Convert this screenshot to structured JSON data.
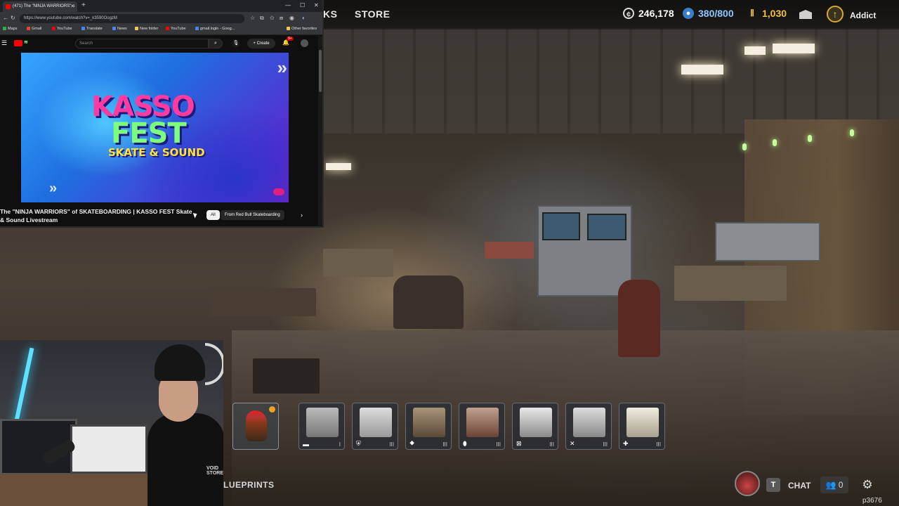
{
  "browser": {
    "tab_title": "(471) The \"NINJA WARRIORS\" o",
    "new_tab_icon": "plus",
    "url": "https://www.youtube.com/watch?v=_k3590OogzM",
    "bookmarks": [
      {
        "label": "Maps",
        "color": "#34a853"
      },
      {
        "label": "Gmail",
        "color": "#ea4335"
      },
      {
        "label": "YouTube",
        "color": "#ff0000"
      },
      {
        "label": "Translate",
        "color": "#4285f4"
      },
      {
        "label": "News",
        "color": "#4285f4"
      },
      {
        "label": "New folder",
        "color": "#f2c94c"
      },
      {
        "label": "YouTube",
        "color": "#ff0000"
      },
      {
        "label": "gmail.login - Goog...",
        "color": "#4285f4"
      }
    ],
    "other_favorites": "Other favorites",
    "search_placeholder": "Search",
    "create_label": "Create",
    "notification_count": "9+",
    "video_art": {
      "line1": "KASSO",
      "line2": "FEST",
      "line3": "SKATE & SOUND"
    },
    "video_title": "The \"NINJA WARRIORS\" of SKATEBOARDING | KASSO FEST Skate & Sound Livestream",
    "chips": [
      "All",
      "From Red Bull Skateboarding"
    ]
  },
  "game": {
    "nav_tabs": [
      "KS",
      "STORE"
    ],
    "currencies": [
      {
        "icon": "coin-icon",
        "value": "246,178",
        "color": "#e0e0e0"
      },
      {
        "icon": "blue-token-icon",
        "value": "380/800",
        "color": "#8fc7ff"
      },
      {
        "icon": "gold-bars-icon",
        "value": "1,030",
        "color": "#f3c040"
      }
    ],
    "player_name": "Addict",
    "hotbar": [
      {
        "icon": "",
        "count": "",
        "art": "rooster"
      },
      {
        "icon": "▬",
        "count": "I",
        "art": "#8a8a8a"
      },
      {
        "icon": "⛨",
        "count": "III",
        "art": "#b8b8b8"
      },
      {
        "icon": "⯁",
        "count": "III",
        "art": "#7a6a52"
      },
      {
        "icon": "⬮",
        "count": "III",
        "art": "#8c5a40"
      },
      {
        "icon": "⊠",
        "count": "III",
        "art": "#a8a8a8"
      },
      {
        "icon": "✕",
        "count": "III",
        "art": "#9a9a9a"
      },
      {
        "icon": "✚",
        "count": "III",
        "art": "#c8c4b8"
      }
    ],
    "blueprints_label": "LUEPRINTS",
    "chat_key": "T",
    "chat_label": "CHAT",
    "friends_count": "0",
    "build_id": "p3676"
  },
  "webcam": {
    "hoodie_logo": "VOID STORE"
  }
}
